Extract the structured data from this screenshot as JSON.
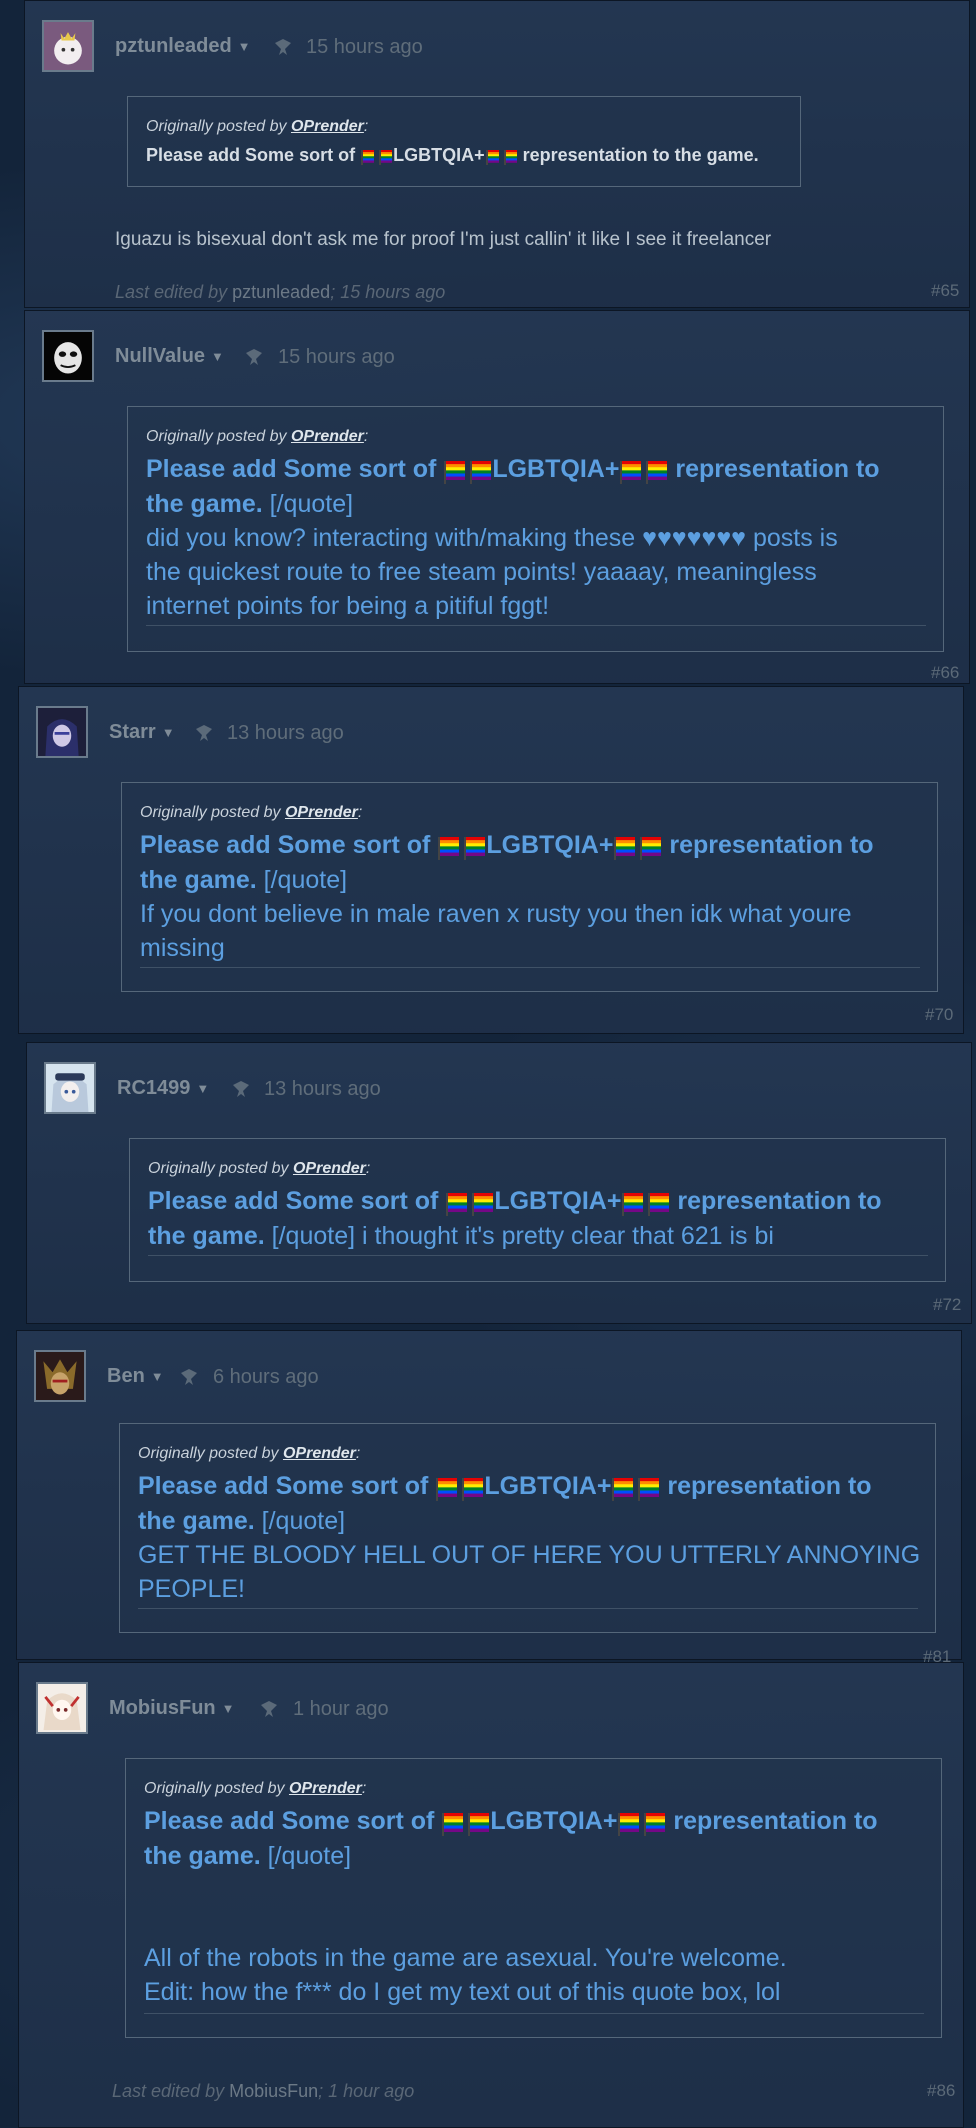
{
  "quote_common": {
    "prefix": "Originally posted by ",
    "author": "OPrender",
    "suffix": ":",
    "bold_lead": "Please add Some sort of",
    "bold_mid": "LGBTQIA+",
    "bold_tail": "representation to",
    "bold_end": "the game.",
    "tag": "[/quote]"
  },
  "posts": [
    {
      "author": "pztunleaded",
      "time": "15 hours ago",
      "quote_line": "Please add Some sort of",
      "quote_line_mid": "LGBTQIA+",
      "quote_line_end": "representation to the game.",
      "text": "Iguazu is bisexual don't ask me for proof I'm just callin' it like I see it freelancer",
      "edited_prefix": "Last edited by ",
      "edited_name": "pztunleaded",
      "edited_suffix": "; 15 hours ago",
      "number": "#65"
    },
    {
      "author": "NullValue",
      "time": "15 hours ago",
      "lines": [
        "did you know? interacting with/making these ♥♥♥♥♥♥♥ posts is",
        "the quickest route to free steam points! yaaaay, meaningless",
        "internet points for being a pitiful fggt!"
      ],
      "number": "#66"
    },
    {
      "author": "Starr",
      "time": "13 hours ago",
      "lines": [
        "If you dont believe in male raven x rusty you then idk what youre",
        "missing"
      ],
      "number": "#70"
    },
    {
      "author": "RC1499",
      "time": "13 hours ago",
      "after_tag": " i thought it's pretty clear that 621 is bi",
      "number": "#72"
    },
    {
      "author": "Ben",
      "time": "6 hours ago",
      "lines": [
        "GET THE BLOODY HELL OUT OF HERE YOU UTTERLY ANNOYING",
        "PEOPLE!"
      ],
      "number": "#81"
    },
    {
      "author": "MobiusFun",
      "time": "1 hour ago",
      "lines": [
        "All of the robots in the game are asexual. You're welcome.",
        "Edit: how the f*** do I get my text out of this quote box, lol"
      ],
      "edited_prefix": "Last edited by ",
      "edited_name": "MobiusFun",
      "edited_suffix": "; 1 hour ago",
      "number": "#86"
    }
  ],
  "colors": {
    "quote_text": "#5c9fe0",
    "post_bg": "#243752",
    "page_bg": "#13243a"
  }
}
